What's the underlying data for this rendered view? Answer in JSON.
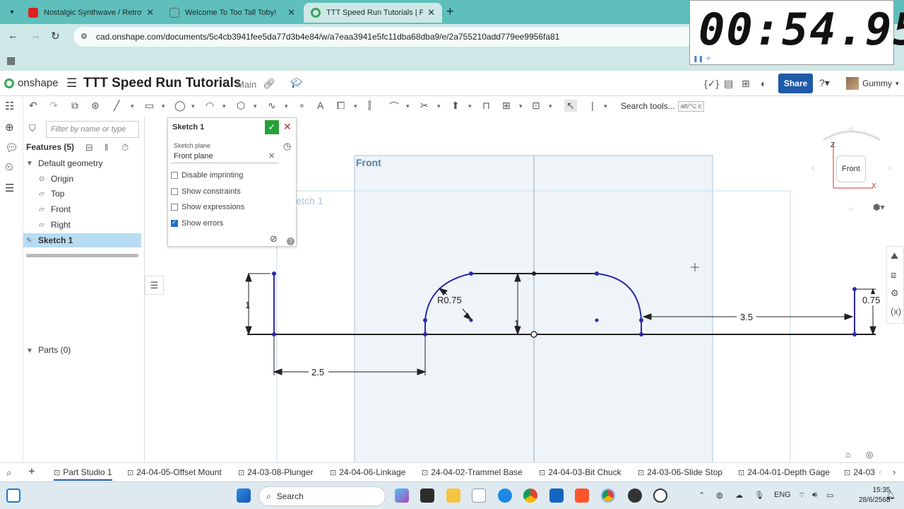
{
  "browser": {
    "tabs": [
      {
        "title": "Nostalgic Synthwave / Retrowa",
        "favicon_color": "#e02020"
      },
      {
        "title": "Welcome To Too Tall Toby!",
        "favicon_color": "#8a8a8a"
      },
      {
        "title": "TTT Speed Run Tutorials | Part S",
        "favicon_color": "#3aa557"
      }
    ],
    "url": "cad.onshape.com/documents/5c4cb3941fee5da77d3b4e84/w/a7eaa3941e5fc11dba68dba9/e/2a755210add779ee9956fa81"
  },
  "timer": {
    "value": "00:54.95"
  },
  "header": {
    "app_name": "onshape",
    "doc_title": "TTT Speed Run Tutorials",
    "branch": "Main",
    "share_label": "Share",
    "user_name": "Gummy"
  },
  "toolbar": {
    "search_label": "Search tools...",
    "search_shortcut": "alt/⌥ c"
  },
  "features": {
    "filter_placeholder": "Filter by name or type",
    "header": "Features (5)",
    "default_geometry": "Default geometry",
    "items": [
      "Origin",
      "Top",
      "Front",
      "Right"
    ],
    "selected": "Sketch 1",
    "parts": "Parts (0)"
  },
  "dialog": {
    "title": "Sketch 1",
    "plane_label": "Sketch plane",
    "plane_value": "Front plane",
    "options": [
      {
        "label": "Disable imprinting",
        "checked": false
      },
      {
        "label": "Show constraints",
        "checked": false
      },
      {
        "label": "Show expressions",
        "checked": false
      },
      {
        "label": "Show errors",
        "checked": true
      }
    ]
  },
  "canvas": {
    "plane_label": "Front",
    "sketch_label": "Sketch 1",
    "dims": {
      "radius": "R0.75",
      "left_height": "1",
      "center_height": "1",
      "right_height": "0.75",
      "right_len": "3.5",
      "left_len": "2.5"
    },
    "viewcube": {
      "face": "Front",
      "z": "Z",
      "x": "X"
    }
  },
  "bottom_tabs": [
    {
      "label": "Part Studio 1",
      "active": true
    },
    {
      "label": "24-04-05-Offset Mount"
    },
    {
      "label": "24-03-08-Plunger"
    },
    {
      "label": "24-04-06-Linkage"
    },
    {
      "label": "24-04-02-Trammel Base"
    },
    {
      "label": "24-04-03-Bit Chuck"
    },
    {
      "label": "24-03-06-Slide Stop"
    },
    {
      "label": "24-04-01-Depth Gage"
    },
    {
      "label": "24-03"
    }
  ],
  "taskbar": {
    "search_label": "Search",
    "lang": "ENG",
    "time": "15:35",
    "date": "28/6/2568"
  }
}
